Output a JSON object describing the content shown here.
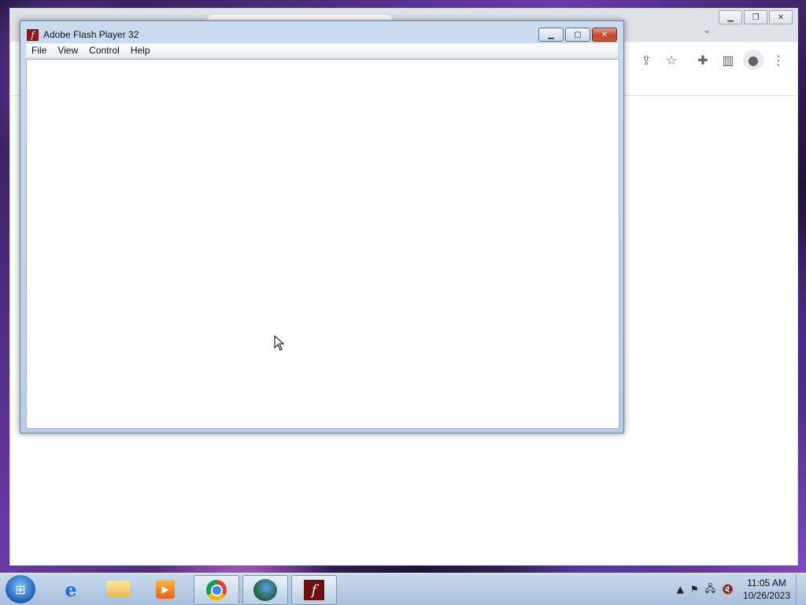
{
  "flash_window": {
    "title": "Adobe Flash Player 32",
    "controls": {
      "minimize": "▁",
      "maximize": "▢",
      "close": "✕"
    },
    "menu": [
      "File",
      "View",
      "Control",
      "Help"
    ]
  },
  "chrome_window": {
    "controls": {
      "minimize": "▁",
      "restore": "❐",
      "close": "✕"
    },
    "tab_search_icon": "⌄",
    "toolbar_icons": [
      "share-icon",
      "star-icon",
      "extensions-icon",
      "sidepanel-icon",
      "profile-icon",
      "menu-icon"
    ],
    "toolbar_glyphs": [
      "⇪",
      "☆",
      "✚",
      "▥",
      "●",
      "⋮"
    ]
  },
  "taskbar": {
    "start_glyph": "⊞",
    "apps": [
      "internet-explorer",
      "windows-explorer",
      "media-center",
      "google-chrome",
      "internet-download-manager",
      "adobe-flash-player"
    ],
    "ie_glyph": "e",
    "media_glyph": "▶",
    "flash_glyph": "f",
    "tray": {
      "arrow": "▲",
      "flag": "⚑",
      "network": "🖧",
      "volume": "🔇"
    },
    "clock_time": "11:05 AM",
    "clock_date": "10/26/2023"
  }
}
